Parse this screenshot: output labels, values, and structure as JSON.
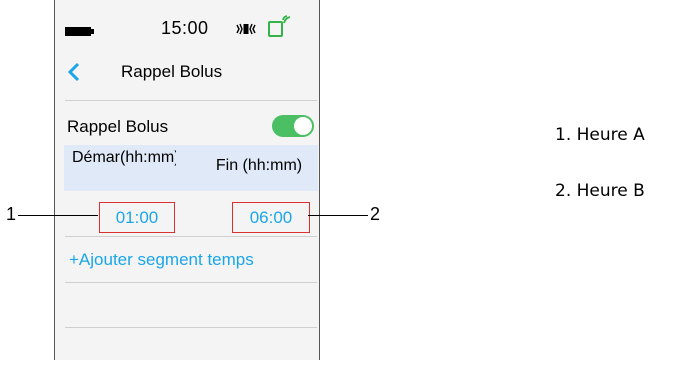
{
  "status_bar": {
    "time": "15:00"
  },
  "header": {
    "title": "Rappel Bolus"
  },
  "reminder": {
    "toggle_label": "Rappel Bolus",
    "toggle_on": true
  },
  "columns": {
    "start_label": "Démar(hh:mm)",
    "end_label": "Fin (hh:mm)"
  },
  "segment": {
    "start_time": "01:00",
    "end_time": "06:00"
  },
  "add_segment_label": "+Ajouter segment temps",
  "callouts": {
    "one": "1",
    "two": "2"
  },
  "legend": [
    "1. Heure A",
    "2. Heure B"
  ],
  "colors": {
    "accent": "#1aa6e8",
    "toggle": "#4bbf63",
    "highlight_box": "#d93030",
    "header_band": "#dfe9f7"
  },
  "icons": [
    "battery-icon",
    "vibrate-icon",
    "signal-icon",
    "back-chevron-icon"
  ]
}
